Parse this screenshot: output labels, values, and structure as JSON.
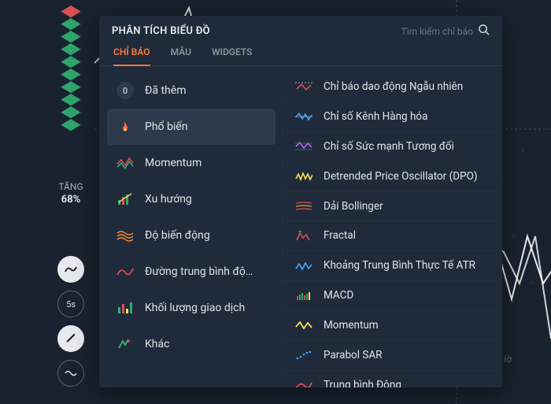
{
  "overlay": {
    "tang_label": "TĂNG",
    "tang_percent": "68%",
    "timeframe_btn": "5s",
    "bg_time": "iờ"
  },
  "panel": {
    "title": "PHÂN TÍCH BIỂU ĐỒ",
    "search_placeholder": "Tìm kiếm chỉ báo",
    "tabs": [
      {
        "label": "CHỈ BÁO",
        "active": true
      },
      {
        "label": "MẪU",
        "active": false
      },
      {
        "label": "WIDGETS",
        "active": false
      }
    ],
    "categories": [
      {
        "icon": "badge",
        "label": "Đã thêm",
        "badge": "0",
        "selected": false
      },
      {
        "icon": "flame",
        "label": "Phổ biến",
        "selected": true
      },
      {
        "icon": "momentum",
        "label": "Momentum",
        "selected": false
      },
      {
        "icon": "trend",
        "label": "Xu hướng",
        "selected": false
      },
      {
        "icon": "volatility",
        "label": "Độ biến động",
        "selected": false
      },
      {
        "icon": "ma",
        "label": "Đường trung bình độ…",
        "selected": false
      },
      {
        "icon": "volume",
        "label": "Khối lượng giao dịch",
        "selected": false
      },
      {
        "icon": "other",
        "label": "Khác",
        "selected": false
      }
    ],
    "indicators": [
      {
        "icon": "stochastic",
        "label": "Chỉ báo dao động Ngẫu nhiên"
      },
      {
        "icon": "cci",
        "label": "Chỉ số Kênh Hàng hóa"
      },
      {
        "icon": "rsi",
        "label": "Chỉ số Sức mạnh Tương đối"
      },
      {
        "icon": "dpo",
        "label": "Detrended Price Oscillator (DPO)"
      },
      {
        "icon": "bollinger",
        "label": "Dải Bollinger"
      },
      {
        "icon": "fractal",
        "label": "Fractal"
      },
      {
        "icon": "atr",
        "label": "Khoảng Trung Bình Thực Tế ATR"
      },
      {
        "icon": "macd",
        "label": "MACD"
      },
      {
        "icon": "momentum2",
        "label": "Momentum"
      },
      {
        "icon": "psar",
        "label": "Parabol SAR"
      },
      {
        "icon": "ema",
        "label": "Trung bình Động"
      }
    ]
  }
}
